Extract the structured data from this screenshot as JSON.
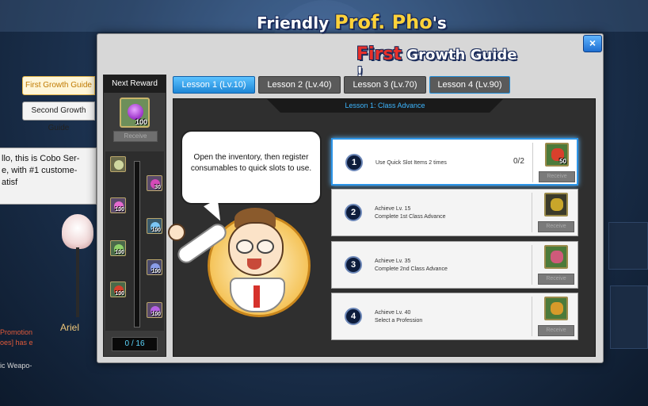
{
  "side_tabs": [
    "First Growth Guide",
    "Second Growth Guide"
  ],
  "chat": {
    "lines": [
      "llo, this is Cobo Ser-",
      "e, with #1 custome-",
      "atisf"
    ]
  },
  "npc": {
    "name": "Ariel"
  },
  "background_text": {
    "promo1": "Promotion",
    "promo2": "oes] has e",
    "promo3": "ic Weapo-"
  },
  "logo": {
    "line1_a": "Friendly ",
    "line1_b": "Prof. Pho",
    "line1_c": "'s",
    "line2_a": "First",
    "line2_b": " Growth Guide !"
  },
  "close_glyph": "×",
  "reward": {
    "header": "Next Reward",
    "big_item": {
      "icon": "purple-potion",
      "qty": "100"
    },
    "receive_label": "Receive",
    "track_items": [
      {
        "icon": "scroll-icon",
        "qty": "",
        "color": "#cfd7a0"
      },
      {
        "icon": "potion-icon",
        "qty": "30",
        "color": "#d54ab8"
      },
      {
        "icon": "elixir-icon",
        "qty": "100",
        "color": "#e66bd0"
      },
      {
        "icon": "elixir-icon",
        "qty": "100",
        "color": "#7bc6f5"
      },
      {
        "icon": "potion-icon",
        "qty": "100",
        "color": "#8fd36a"
      },
      {
        "icon": "potion-icon",
        "qty": "100",
        "color": "#8a9ee8"
      },
      {
        "icon": "apple-icon",
        "qty": "100",
        "color": "#d8402c"
      },
      {
        "icon": "potion-icon",
        "qty": "100",
        "color": "#b561e3"
      }
    ],
    "progress": "0 / 16"
  },
  "tabs": [
    {
      "label": "Lesson 1 (Lv.10)",
      "active": true
    },
    {
      "label": "Lesson 2 (Lv.40)",
      "active": false
    },
    {
      "label": "Lesson 3 (Lv.70)",
      "active": false
    },
    {
      "label": "Lesson 4 (Lv.90)",
      "active": false
    }
  ],
  "lesson_title": "Lesson 1: Class Advance",
  "speech": "Open the inventory, then register consumables to quick slots to use.",
  "quests": [
    {
      "num": "1",
      "line1": "Use Quick Slot Items 2 times",
      "line2": "",
      "progress": "0/2",
      "item_icon": "apple-icon",
      "item_color": "#d8402c",
      "qty": "50",
      "receive": "Receive",
      "active": true
    },
    {
      "num": "2",
      "line1": "Achieve Lv. 15",
      "line2": "Complete 1st Class Advance",
      "progress": "",
      "item_icon": "gift-box-icon",
      "item_color": "#c9a62a",
      "qty": "",
      "receive": "Receive",
      "active": false
    },
    {
      "num": "3",
      "line1": "Achieve Lv. 35",
      "line2": "Complete 2nd Class Advance",
      "progress": "",
      "item_icon": "scroll-icon",
      "item_color": "#cf5a7a",
      "qty": "",
      "receive": "Receive",
      "active": false
    },
    {
      "num": "4",
      "line1": "Achieve Lv. 40",
      "line2": "Select a Profession",
      "progress": "",
      "item_icon": "chest-icon",
      "item_color": "#d89a2a",
      "qty": "",
      "receive": "Receive",
      "active": false
    }
  ]
}
